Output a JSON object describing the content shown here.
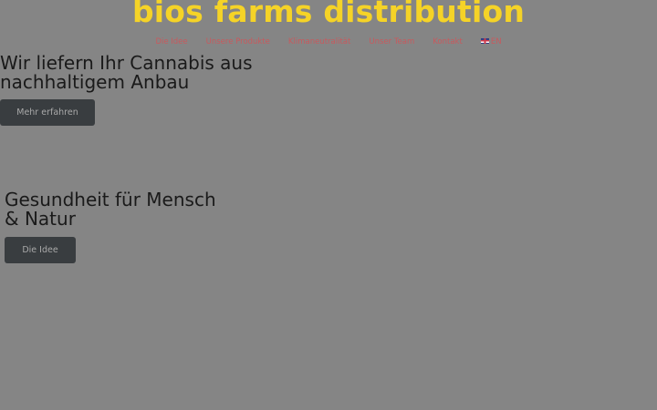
{
  "brand": {
    "name": "bios farms distribution",
    "color": "#f5d327"
  },
  "nav": {
    "items": [
      {
        "label": "Die Idee"
      },
      {
        "label": "Unsere Produkte"
      },
      {
        "label": "Klimaneutralität"
      },
      {
        "label": "Unser Team"
      },
      {
        "label": "Kontakt"
      }
    ],
    "language": {
      "label": "EN",
      "icon": "uk-flag-icon"
    },
    "link_color": "#c75a5e"
  },
  "hero": {
    "title": "Wir liefern Ihr Cannabis aus nachhaltigem Anbau",
    "button_label": "Mehr erfahren"
  },
  "section": {
    "title": "Gesundheit für Mensch & Natur",
    "button_label": "Die Idee"
  },
  "colors": {
    "overlay_background": "#858585",
    "button_background": "#393d40",
    "button_text": "#a9a9a9"
  }
}
